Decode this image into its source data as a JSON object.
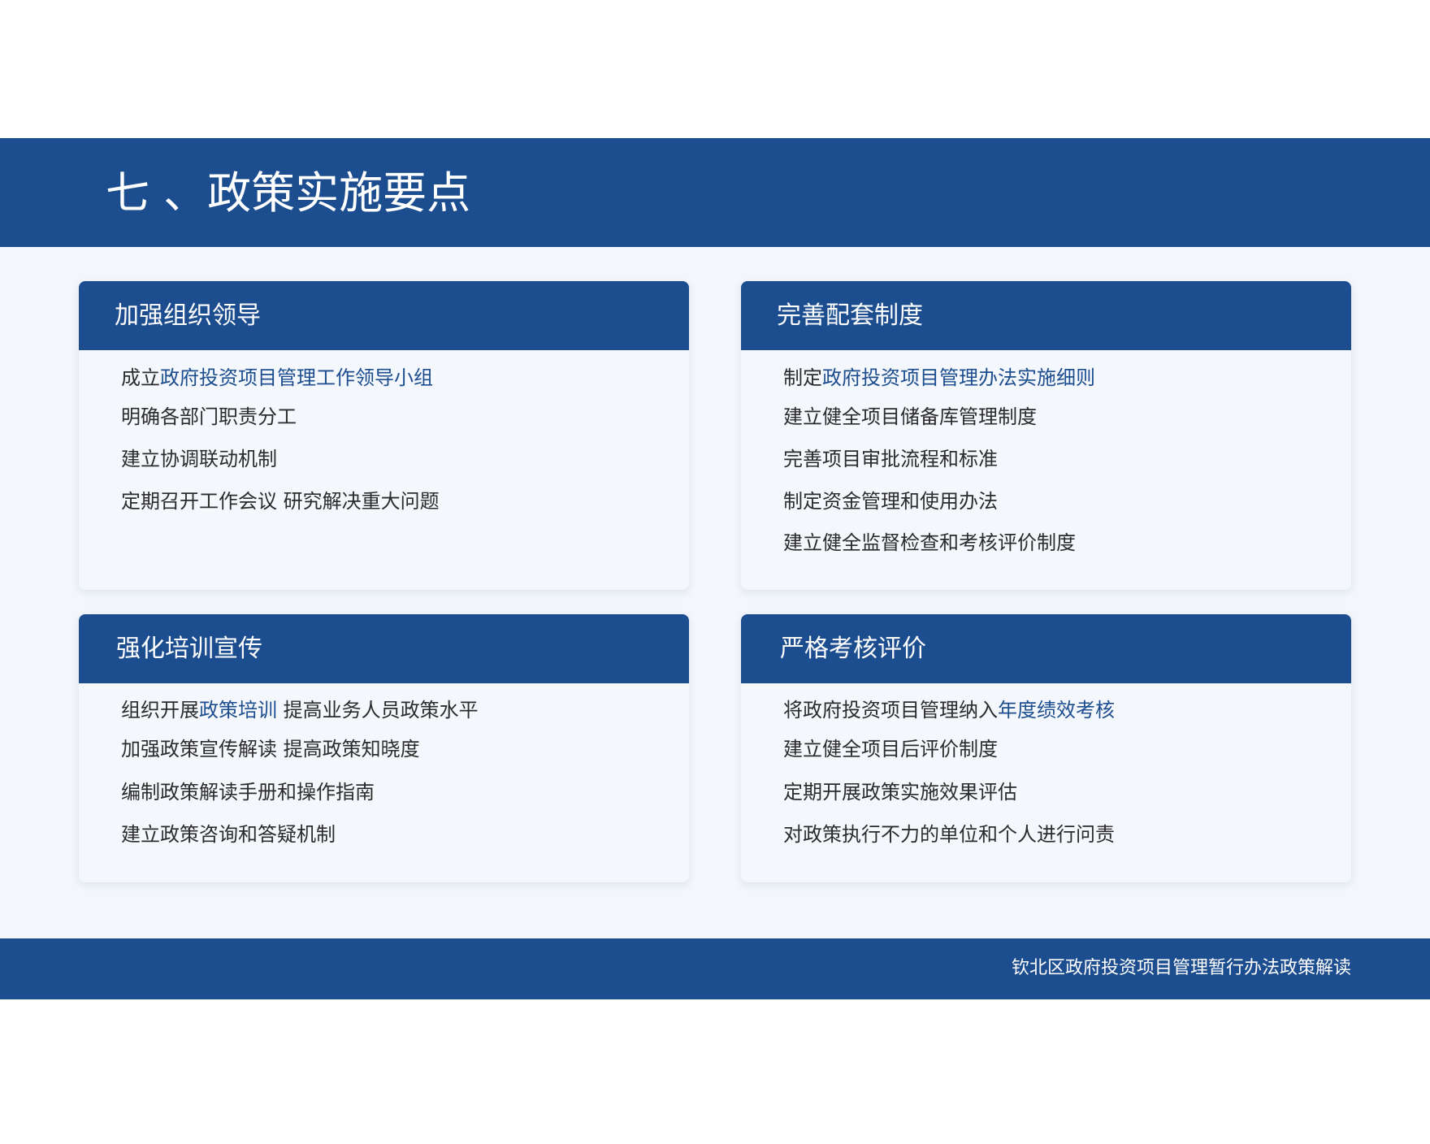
{
  "slide": {
    "title": "七 、政策实施要点"
  },
  "cards": [
    {
      "title": "加强组织领导",
      "items": [
        {
          "prefix": "成立",
          "highlight": "政府投资项目管理工作领导小组",
          "suffix": ""
        },
        {
          "prefix": "明确各部门职责分工",
          "highlight": "",
          "suffix": ""
        },
        {
          "prefix": "建立协调联动机制",
          "highlight": "",
          "suffix": ""
        },
        {
          "prefix": "定期召开工作会议 研究解决重大问题",
          "highlight": "",
          "suffix": ""
        }
      ]
    },
    {
      "title": "完善配套制度",
      "items": [
        {
          "prefix": "制定",
          "highlight": "政府投资项目管理办法实施细则",
          "suffix": ""
        },
        {
          "prefix": "建立健全项目储备库管理制度",
          "highlight": "",
          "suffix": ""
        },
        {
          "prefix": "完善项目审批流程和标准",
          "highlight": "",
          "suffix": ""
        },
        {
          "prefix": "制定资金管理和使用办法",
          "highlight": "",
          "suffix": ""
        },
        {
          "prefix": "建立健全监督检查和考核评价制度",
          "highlight": "",
          "suffix": ""
        }
      ]
    },
    {
      "title": "强化培训宣传",
      "items": [
        {
          "prefix": "组织开展",
          "highlight": "政策培训",
          "suffix": " 提高业务人员政策水平"
        },
        {
          "prefix": "加强政策宣传解读 提高政策知晓度",
          "highlight": "",
          "suffix": ""
        },
        {
          "prefix": "编制政策解读手册和操作指南",
          "highlight": "",
          "suffix": ""
        },
        {
          "prefix": "建立政策咨询和答疑机制",
          "highlight": "",
          "suffix": ""
        }
      ]
    },
    {
      "title": "严格考核评价",
      "items": [
        {
          "prefix": "将政府投资项目管理纳入",
          "highlight": "年度绩效考核",
          "suffix": ""
        },
        {
          "prefix": "建立健全项目后评价制度",
          "highlight": "",
          "suffix": ""
        },
        {
          "prefix": "定期开展政策实施效果评估",
          "highlight": "",
          "suffix": ""
        },
        {
          "prefix": "对政策执行不力的单位和个人进行问责",
          "highlight": "",
          "suffix": ""
        }
      ]
    }
  ],
  "footer": {
    "text": "钦北区政府投资项目管理暂行办法政策解读"
  },
  "colors": {
    "brand_blue": "#1c4d8f",
    "background": "#f3f7fc",
    "body_text": "#2b2b2b"
  }
}
